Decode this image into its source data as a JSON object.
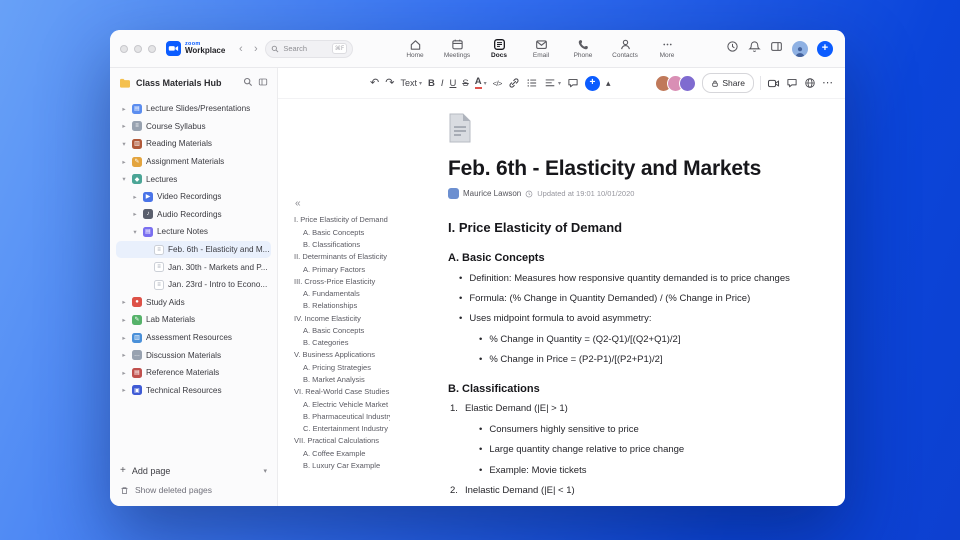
{
  "colors": {
    "accent": "#0b5cff",
    "selection_bg": "#e9f0fc",
    "window_bg": "#ffffff"
  },
  "icons": {
    "undo": "↶",
    "redo": "↷",
    "chevron_down": "▾",
    "chevron_right": "▸",
    "back": "‹",
    "forward": "›",
    "more_h": "⋯",
    "code": "</>",
    "toc_collapse": "«",
    "plus": "+",
    "bullet": "•",
    "collapse_up": "▴"
  },
  "titlebar": {
    "brand_top": "zoom",
    "brand_bottom": "Workplace",
    "search_placeholder": "Search",
    "search_shortcut": "⌘F",
    "tabs": [
      {
        "label": "Home"
      },
      {
        "label": "Meetings"
      },
      {
        "label": "Docs"
      },
      {
        "label": "Email"
      },
      {
        "label": "Phone"
      },
      {
        "label": "Contacts"
      },
      {
        "label": "More"
      }
    ]
  },
  "sidebar": {
    "title": "Class Materials Hub",
    "items": [
      {
        "label": "Lecture Slides/Presentations",
        "depth": 0,
        "chevron": "collapsed",
        "icon_name": "slides-icon",
        "icon_color": "#5b8def",
        "icon_glyph": "▤"
      },
      {
        "label": "Course Syllabus",
        "depth": 0,
        "chevron": "collapsed",
        "icon_name": "syllabus-icon",
        "icon_color": "#98a2b0",
        "icon_glyph": "≡"
      },
      {
        "label": "Reading Materials",
        "depth": 0,
        "chevron": "expanded",
        "icon_name": "book-icon",
        "icon_color": "#b0593a",
        "icon_glyph": "▥"
      },
      {
        "label": "Assignment Materials",
        "depth": 0,
        "chevron": "collapsed",
        "icon_name": "assignment-icon",
        "icon_color": "#e3a43e",
        "icon_glyph": "✎"
      },
      {
        "label": "Lectures",
        "depth": 0,
        "chevron": "expanded",
        "icon_name": "lectures-icon",
        "icon_color": "#4ba596",
        "icon_glyph": "◆"
      },
      {
        "label": "Video Recordings",
        "depth": 1,
        "chevron": "collapsed",
        "icon_name": "video-icon",
        "icon_color": "#4a74e8",
        "icon_glyph": "▶"
      },
      {
        "label": "Audio Recordings",
        "depth": 1,
        "chevron": "collapsed",
        "icon_name": "audio-icon",
        "icon_color": "#5a5f6d",
        "icon_glyph": "♪"
      },
      {
        "label": "Lecture Notes",
        "depth": 1,
        "chevron": "expanded",
        "icon_name": "notes-icon",
        "icon_color": "#7a6ff0",
        "icon_glyph": "▤"
      },
      {
        "label": "Feb. 6th - Elasticity and M...",
        "depth": 2,
        "chevron": "none",
        "icon": "doc",
        "selected": true
      },
      {
        "label": "Jan. 30th - Markets and P...",
        "depth": 2,
        "chevron": "none",
        "icon": "doc"
      },
      {
        "label": "Jan. 23rd - Intro to Econo...",
        "depth": 2,
        "chevron": "none",
        "icon": "doc"
      },
      {
        "label": "Study Aids",
        "depth": 0,
        "chevron": "collapsed",
        "icon_name": "apple-icon",
        "icon_color": "#dd5147",
        "icon_glyph": "●"
      },
      {
        "label": "Lab Materials",
        "depth": 0,
        "chevron": "collapsed",
        "icon_name": "pencil-icon",
        "icon_color": "#56b26a",
        "icon_glyph": "✎"
      },
      {
        "label": "Assessment Resources",
        "depth": 0,
        "chevron": "collapsed",
        "icon_name": "chart-icon",
        "icon_color": "#4a90d9",
        "icon_glyph": "▥"
      },
      {
        "label": "Discussion Materials",
        "depth": 0,
        "chevron": "collapsed",
        "icon_name": "chat-icon",
        "icon_color": "#98a2b0",
        "icon_glyph": "…"
      },
      {
        "label": "Reference Materials",
        "depth": 0,
        "chevron": "collapsed",
        "icon_name": "books-icon",
        "icon_color": "#c0504d",
        "icon_glyph": "▤"
      },
      {
        "label": "Technical Resources",
        "depth": 0,
        "chevron": "collapsed",
        "icon_name": "manual-icon",
        "icon_color": "#3f5bd5",
        "icon_glyph": "▣"
      }
    ],
    "add_page": "Add page",
    "show_deleted": "Show deleted pages"
  },
  "toolbar": {
    "style_selector": "Text",
    "bold": "B",
    "italic": "I",
    "underline": "U",
    "strike": "S",
    "font_color": "A",
    "share_label": "Share",
    "collaborator_colors": [
      "#c0795a",
      "#d98fb5",
      "#7f6bd0"
    ]
  },
  "toc": {
    "items": [
      {
        "text": "I. Price Elasticity of Demand",
        "level": 0
      },
      {
        "text": "A. Basic Concepts",
        "level": 1
      },
      {
        "text": "B. Classifications",
        "level": 1
      },
      {
        "text": "II. Determinants of Elasticity",
        "level": 0
      },
      {
        "text": "A. Primary Factors",
        "level": 1
      },
      {
        "text": "III. Cross-Price Elasticity",
        "level": 0
      },
      {
        "text": "A. Fundamentals",
        "level": 1
      },
      {
        "text": "B. Relationships",
        "level": 1
      },
      {
        "text": "IV. Income Elasticity",
        "level": 0
      },
      {
        "text": "A. Basic Concepts",
        "level": 1
      },
      {
        "text": "B. Categories",
        "level": 1
      },
      {
        "text": "V. Business Applications",
        "level": 0
      },
      {
        "text": "A. Pricing Strategies",
        "level": 1
      },
      {
        "text": "B. Market Analysis",
        "level": 1
      },
      {
        "text": "VI. Real-World Case Studies",
        "level": 0
      },
      {
        "text": "A. Electric Vehicle Market",
        "level": 1
      },
      {
        "text": "B. Pharmaceutical Industry",
        "level": 1
      },
      {
        "text": "C. Entertainment Industry",
        "level": 1
      },
      {
        "text": "VII. Practical Calculations",
        "level": 0
      },
      {
        "text": "A. Coffee Example",
        "level": 1
      },
      {
        "text": "B. Luxury Car Example",
        "level": 1
      }
    ]
  },
  "doc": {
    "title": "Feb. 6th - Elasticity and Markets",
    "author": "Maurice Lawson",
    "updated": "Updated at 19:01 10/01/2020",
    "blocks": [
      {
        "type": "h2",
        "text": "I. Price Elasticity of Demand"
      },
      {
        "type": "h3",
        "text": "A. Basic Concepts"
      },
      {
        "type": "bullet",
        "level": 1,
        "text": "Definition: Measures how responsive quantity demanded is to price changes"
      },
      {
        "type": "bullet",
        "level": 1,
        "text": "Formula: (% Change in Quantity Demanded) / (% Change in Price)"
      },
      {
        "type": "bullet",
        "level": 1,
        "text": "Uses midpoint formula to avoid asymmetry:"
      },
      {
        "type": "bullet",
        "level": 2,
        "text": "% Change in Quantity = (Q2-Q1)/[(Q2+Q1)/2]"
      },
      {
        "type": "bullet",
        "level": 2,
        "text": "% Change in Price = (P2-P1)/[(P2+P1)/2]"
      },
      {
        "type": "h3",
        "text": "B. Classifications"
      },
      {
        "type": "number",
        "marker": "1.",
        "text": "Elastic Demand (|E| > 1)"
      },
      {
        "type": "bullet",
        "level": 2,
        "text": "Consumers highly sensitive to price"
      },
      {
        "type": "bullet",
        "level": 2,
        "text": "Large quantity change relative to price change"
      },
      {
        "type": "bullet",
        "level": 2,
        "text": "Example: Movie tickets"
      },
      {
        "type": "number",
        "marker": "2.",
        "text": "Inelastic Demand (|E| < 1)"
      }
    ]
  }
}
